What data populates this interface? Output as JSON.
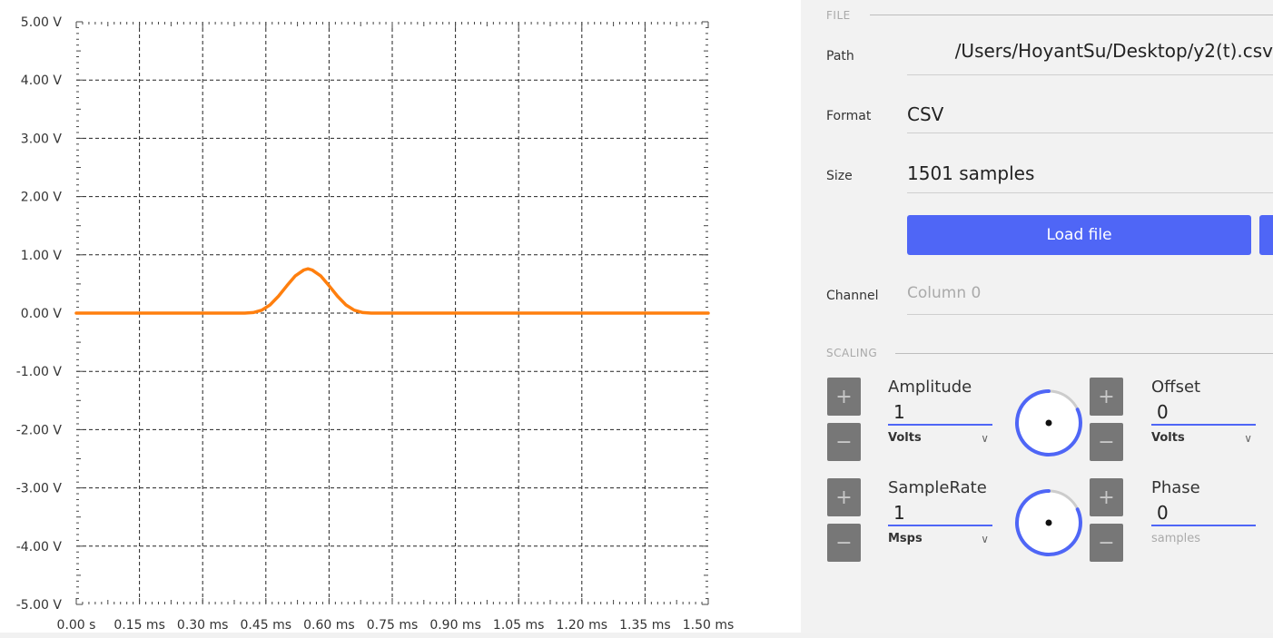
{
  "chart_data": {
    "type": "line",
    "title": "",
    "xlabel": "",
    "ylabel": "",
    "x_ticks": [
      "0.00 s",
      "0.15 ms",
      "0.30 ms",
      "0.45 ms",
      "0.60 ms",
      "0.75 ms",
      "0.90 ms",
      "1.05 ms",
      "1.20 ms",
      "1.35 ms",
      "1.50 ms"
    ],
    "y_ticks": [
      "5.00 V",
      "4.00 V",
      "3.00 V",
      "2.00 V",
      "1.00 V",
      "0.00 V",
      "-1.00 V",
      "-2.00 V",
      "-3.00 V",
      "-4.00 V",
      "-5.00 V"
    ],
    "xlim": [
      0,
      1.5
    ],
    "ylim": [
      -5,
      5
    ],
    "x_unit": "ms",
    "y_unit": "V",
    "grid": true,
    "line_color": "#ff7f0e",
    "series": [
      {
        "x": [
          0,
          0.3,
          0.4,
          0.42,
          0.44,
          0.46,
          0.48,
          0.5,
          0.52,
          0.54,
          0.55,
          0.56,
          0.58,
          0.6,
          0.62,
          0.64,
          0.66,
          0.68,
          0.7,
          0.8,
          1.0,
          1.5
        ],
        "y": [
          0,
          0,
          0,
          0.01,
          0.05,
          0.14,
          0.29,
          0.47,
          0.64,
          0.74,
          0.76,
          0.74,
          0.64,
          0.47,
          0.29,
          0.14,
          0.05,
          0.01,
          0,
          0,
          0,
          0
        ]
      }
    ]
  },
  "file_section": {
    "title": "FILE",
    "path_label": "Path",
    "path_value": "/Users/HoyantSu/Desktop/y2(t).csv",
    "format_label": "Format",
    "format_value": "CSV",
    "size_label": "Size",
    "size_value": "1501 samples",
    "load_button": "Load file",
    "channel_label": "Channel",
    "channel_placeholder": "Column 0"
  },
  "scaling_section": {
    "title": "SCALING",
    "plus": "+",
    "minus": "−",
    "amplitude": {
      "label": "Amplitude",
      "value": "1",
      "unit": "Volts"
    },
    "offset": {
      "label": "Offset",
      "value": "0",
      "unit": "Volts"
    },
    "samplerate": {
      "label": "SampleRate",
      "value": "1",
      "unit": "Msps"
    },
    "phase": {
      "label": "Phase",
      "value": "0",
      "unit": "samples"
    }
  },
  "colors": {
    "accent": "#4f66f6",
    "trace": "#ff7f0e"
  }
}
